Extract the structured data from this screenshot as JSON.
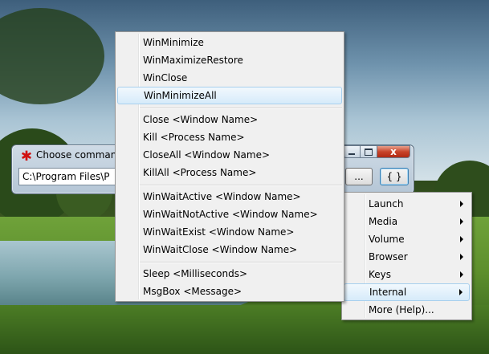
{
  "dialog": {
    "title": "Choose command",
    "input_value": "C:\\Program Files\\P",
    "browse_label": "...",
    "braces_label": "{ }",
    "close_glyph": "x"
  },
  "main_menu": {
    "groups": [
      [
        "WinMinimize",
        "WinMaximizeRestore",
        "WinClose",
        "WinMinimizeAll"
      ],
      [
        "Close <Window Name>",
        "Kill <Process Name>",
        "CloseAll <Window Name>",
        "KillAll <Process Name>"
      ],
      [
        "WinWaitActive <Window Name>",
        "WinWaitNotActive <Window Name>",
        "WinWaitExist <Window Name>",
        "WinWaitClose <Window Name>"
      ],
      [
        "Sleep <Milliseconds>",
        "MsgBox <Message>"
      ]
    ],
    "highlighted": "WinMinimizeAll"
  },
  "sub_menu": {
    "items": [
      "Launch",
      "Media",
      "Volume",
      "Browser",
      "Keys",
      "Internal",
      "More (Help)..."
    ],
    "highlighted": "Internal"
  },
  "icons": {
    "dialog_icon": "asterisk-icon",
    "submenu_arrow": "chevron-right-icon"
  },
  "colors": {
    "menu_bg": "#f0f0f0",
    "highlight": "#d6ebfa",
    "dialog_frame": "#b5c6d6",
    "close_button": "#c8432a"
  }
}
